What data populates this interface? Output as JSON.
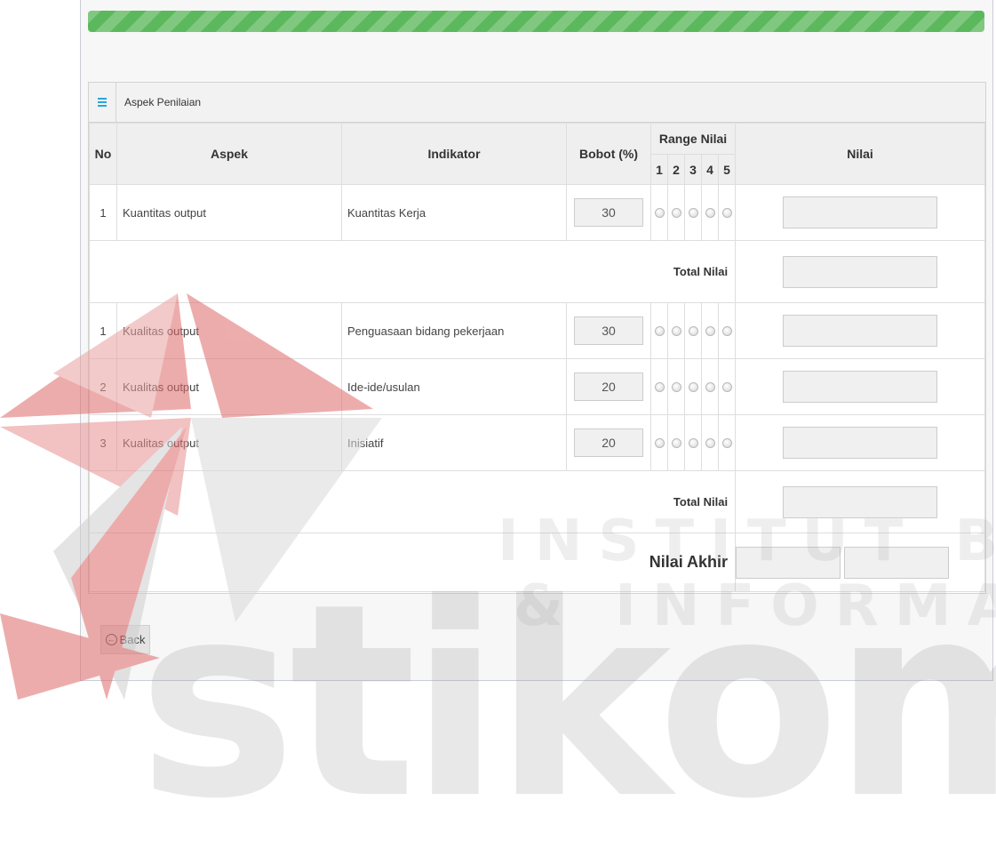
{
  "panel": {
    "title": "Aspek Penilaian"
  },
  "table": {
    "headers": {
      "no": "No",
      "aspek": "Aspek",
      "indikator": "Indikator",
      "bobot": "Bobot (%)",
      "range": "Range Nilai",
      "range_cols": [
        "1",
        "2",
        "3",
        "4",
        "5"
      ],
      "nilai": "Nilai"
    },
    "group1": [
      {
        "no": "1",
        "aspek": "Kuantitas output",
        "indikator": "Kuantitas Kerja",
        "bobot": "30"
      }
    ],
    "group2": [
      {
        "no": "1",
        "aspek": "Kualitas output",
        "indikator": "Penguasaan bidang pekerjaan",
        "bobot": "30"
      },
      {
        "no": "2",
        "aspek": "Kualitas output",
        "indikator": "Ide-ide/usulan",
        "bobot": "20"
      },
      {
        "no": "3",
        "aspek": "Kualitas output",
        "indikator": "Inisiatif",
        "bobot": "20"
      }
    ],
    "total_label": "Total Nilai",
    "nilai_akhir_label": "Nilai Akhir"
  },
  "buttons": {
    "back": "Back"
  },
  "watermark": {
    "line1": "INSTITUT BISNIS",
    "line2": "& INFORMATIKA",
    "logo": "stikom"
  },
  "colors": {
    "progress": "#5cb85c",
    "icon": "#2aa7d8",
    "logo_red": "#e06a6a"
  },
  "icons": {
    "panel": "list-icon",
    "back": "arrow-left-circle-icon"
  }
}
